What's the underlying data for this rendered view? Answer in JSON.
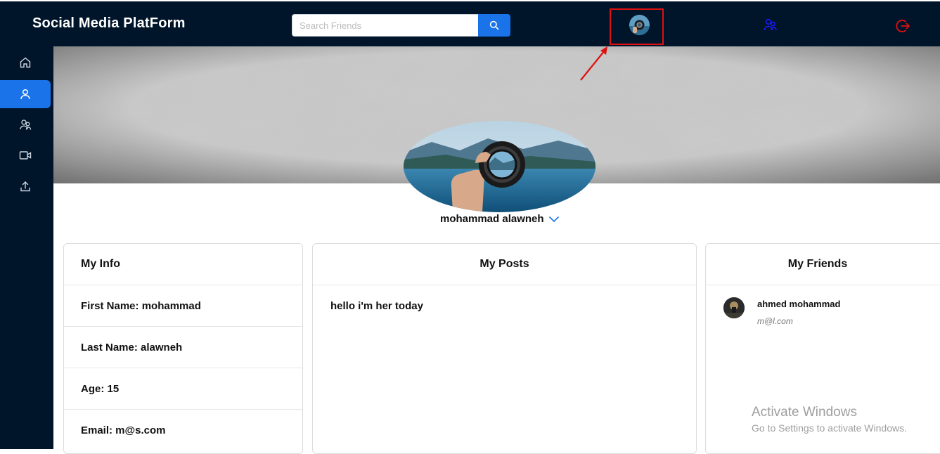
{
  "header": {
    "brand": "Social Media PlatForm",
    "search_placeholder": "Search Friends"
  },
  "profile": {
    "name": "mohammad alawneh"
  },
  "info_card": {
    "title": "My Info",
    "rows": [
      "First Name: mohammad",
      "Last Name: alawneh",
      "Age: 15",
      "Email: m@s.com"
    ]
  },
  "posts_card": {
    "title": "My Posts",
    "posts": [
      "hello i'm her today"
    ]
  },
  "friends_card": {
    "title": "My Friends",
    "friends": [
      {
        "name": "ahmed mohammad",
        "email": "m@l.com"
      }
    ]
  },
  "watermark": {
    "title": "Activate Windows",
    "subtitle": "Go to Settings to activate Windows."
  },
  "colors": {
    "nav_bg": "#00142a",
    "accent": "#1a73e8",
    "annotation_red": "#e01010"
  },
  "icons": {
    "sidebar": [
      "home-icon",
      "user-icon",
      "friends-icon",
      "video-icon",
      "upload-icon"
    ],
    "top": [
      "search-icon",
      "friends-icon",
      "logout-icon"
    ]
  }
}
